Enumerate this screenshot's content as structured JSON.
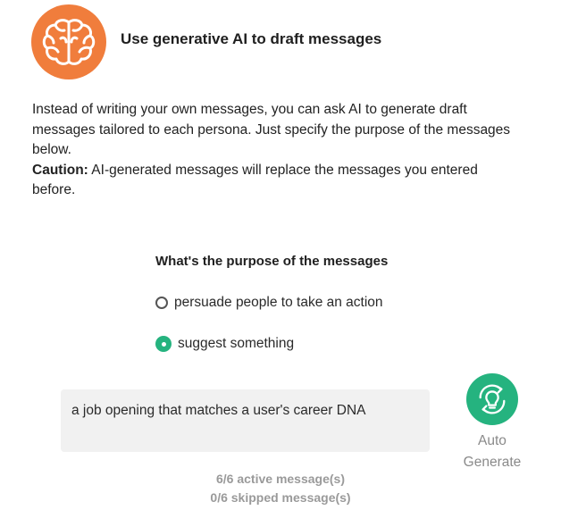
{
  "header": {
    "title": "Use generative AI to draft messages",
    "icon": "brain-icon",
    "icon_bg_color": "#f07d3c"
  },
  "intro": {
    "text": "Instead of writing your own messages, you can ask AI to generate draft messages tailored to each persona. Just specify the purpose of the messages below.",
    "caution_label": "Caution:",
    "caution_text": " AI-generated messages will replace the messages you entered before."
  },
  "purpose": {
    "title": "What's the purpose of the messages",
    "options": [
      {
        "label": "persuade people to take an action",
        "selected": false
      },
      {
        "label": "suggest something",
        "selected": true
      }
    ],
    "input_value": "a job opening that matches a user's career DNA"
  },
  "auto_generate": {
    "label_line1": "Auto",
    "label_line2": "Generate",
    "icon": "lightbulb-refresh-icon",
    "accent_color": "#25b37f"
  },
  "status": {
    "active": "6/6 active message(s)",
    "skipped": "0/6 skipped message(s)"
  }
}
